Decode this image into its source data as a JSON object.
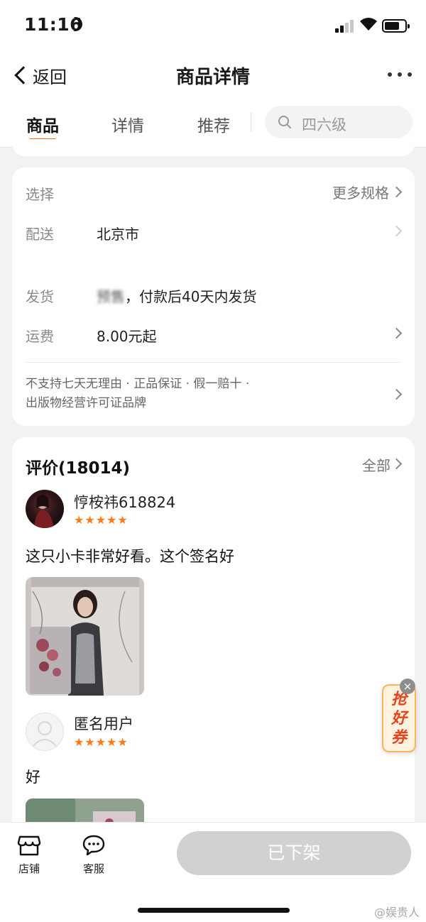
{
  "status_bar": {
    "time": "11:16"
  },
  "nav": {
    "back_label": "返回",
    "title": "商品详情"
  },
  "tabs": [
    {
      "label": "商品",
      "active": true
    },
    {
      "label": "详情",
      "active": false
    },
    {
      "label": "推荐",
      "active": false
    }
  ],
  "search": {
    "placeholder": "四六级"
  },
  "info": {
    "select": {
      "label": "选择",
      "action": "更多规格"
    },
    "delivery": {
      "label": "配送",
      "value": "北京市"
    },
    "shipping": {
      "label": "发货",
      "value_blurred": "预售",
      "value": "，付款后40天内发货"
    },
    "freight": {
      "label": "运费",
      "value": "8.00元起"
    },
    "guarantee_line1": "不支持七天无理由 · 正品保证 · 假一赔十 ·",
    "guarantee_line2": "出版物经营许可证品牌"
  },
  "reviews": {
    "title": "评价(18014)",
    "all_label": "全部",
    "items": [
      {
        "user": "悙桉祎618824",
        "stars": "★★★★★",
        "text": "这只小卡非常好看。这个签名好"
      },
      {
        "user": "匿名用户",
        "stars": "★★★★★",
        "text": "好"
      }
    ]
  },
  "coupon": {
    "line1": "抢",
    "line2": "好",
    "line3": "券",
    "close": "×"
  },
  "bottom": {
    "store_label": "店铺",
    "service_label": "客服",
    "status_button": "已下架"
  },
  "watermark": "@娱贵人",
  "colors": {
    "accent": "#ff6a00",
    "star": "#ff7a1a",
    "disabled_button": "#d1d1d1"
  }
}
